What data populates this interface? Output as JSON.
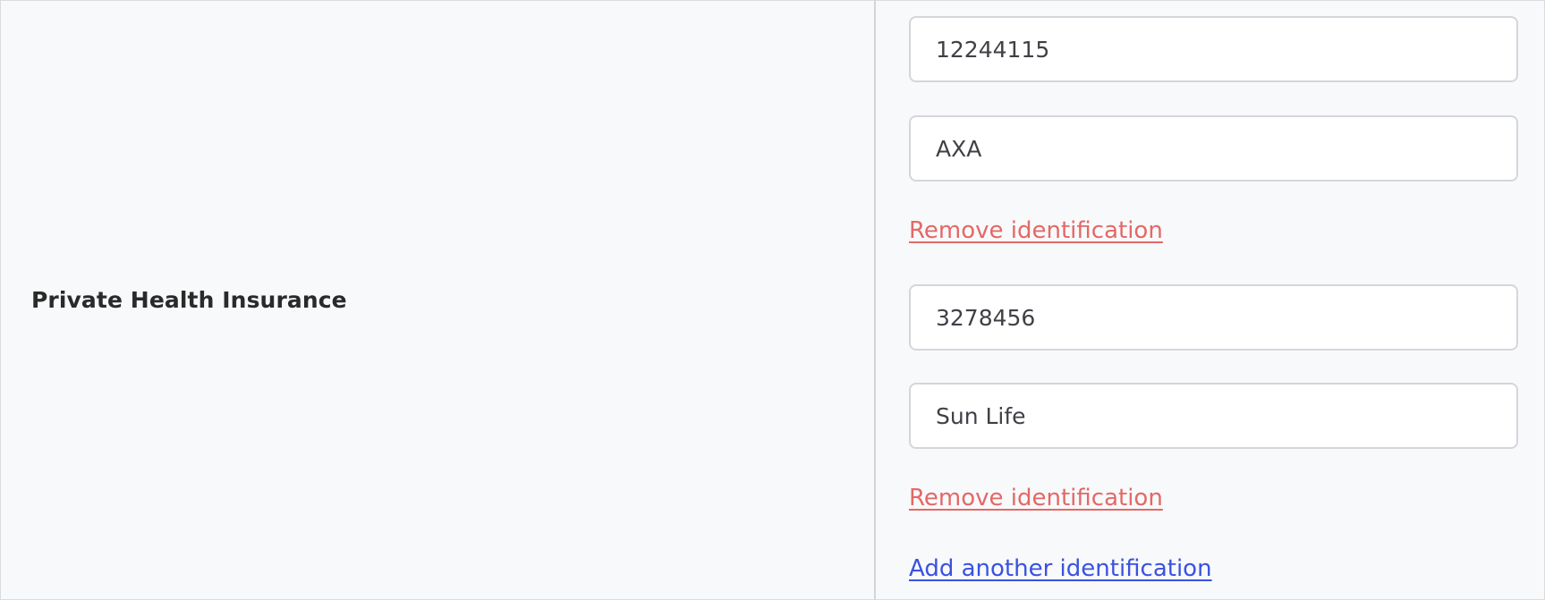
{
  "section": {
    "label": "Private Health Insurance"
  },
  "identifications": [
    {
      "number": "12244115",
      "provider": "AXA",
      "remove_label": "Remove identification"
    },
    {
      "number": "3278456",
      "provider": "Sun Life",
      "remove_label": "Remove identification"
    }
  ],
  "actions": {
    "add_label": "Add another identification"
  },
  "colors": {
    "remove_link": "#e46867",
    "add_link": "#3a52e0",
    "background": "#f8f9fa"
  }
}
